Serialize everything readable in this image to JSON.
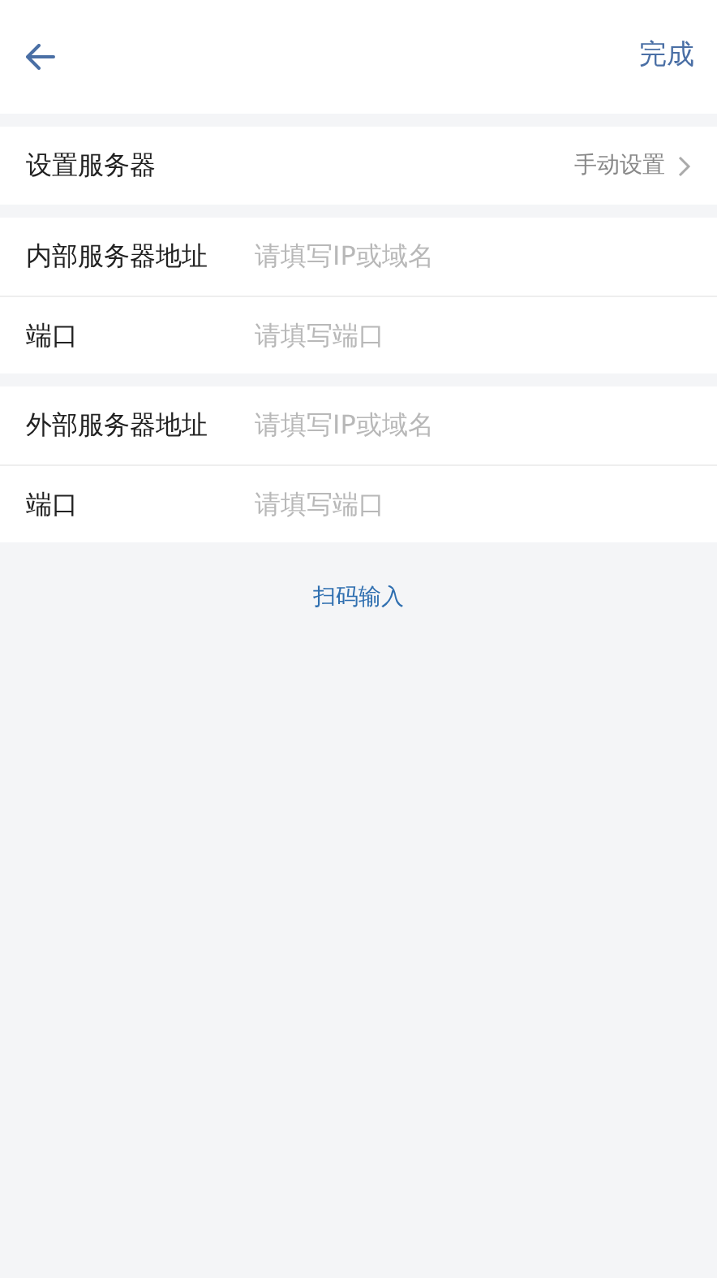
{
  "header": {
    "done": "完成"
  },
  "server_mode": {
    "label": "设置服务器",
    "value": "手动设置"
  },
  "groups": [
    {
      "fields": [
        {
          "label": "内部服务器地址",
          "placeholder": "请填写IP或域名"
        },
        {
          "label": "端口",
          "placeholder": "请填写端口"
        }
      ]
    },
    {
      "fields": [
        {
          "label": "外部服务器地址",
          "placeholder": "请填写IP或域名"
        },
        {
          "label": "端口",
          "placeholder": "请填写端口"
        }
      ]
    }
  ],
  "scan_link": "扫码输入"
}
